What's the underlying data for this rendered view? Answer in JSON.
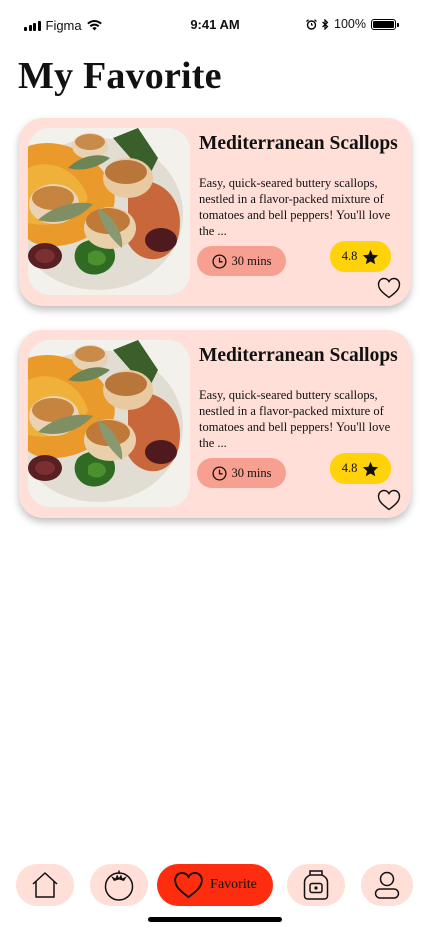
{
  "status_bar": {
    "carrier": "Figma",
    "time": "9:41 AM",
    "battery": "100%",
    "icons": [
      "signal-icon",
      "wifi-icon",
      "alarm-icon",
      "bluetooth-icon",
      "battery-icon"
    ]
  },
  "page": {
    "title": "My Favorite"
  },
  "recipes": [
    {
      "title": "Mediterranean Scallops",
      "description": "Easy, quick-seared buttery scallops, nestled in a flavor-packed mixture of tomatoes and bell peppers! You'll love the ...",
      "time": "30 mins",
      "rating": "4.8",
      "favorited": true
    },
    {
      "title": "Mediterranean Scallops",
      "description": "Easy, quick-seared buttery scallops, nestled in a flavor-packed mixture of tomatoes and bell peppers! You'll love the ...",
      "time": "30 mins",
      "rating": "4.8",
      "favorited": true
    }
  ],
  "nav": {
    "items": [
      {
        "icon": "home-icon",
        "label": ""
      },
      {
        "icon": "tomato-icon",
        "label": ""
      },
      {
        "icon": "heart-icon",
        "label": "Favorite",
        "active": true
      },
      {
        "icon": "pantry-jar-icon",
        "label": ""
      },
      {
        "icon": "profile-icon",
        "label": ""
      }
    ]
  },
  "colors": {
    "card_bg": "#ffdfd7",
    "time_pill": "#f7a091",
    "rating_pill": "#ffd20a",
    "nav_active": "#ff2d0f",
    "nav_bg": "#ffdfd7"
  }
}
